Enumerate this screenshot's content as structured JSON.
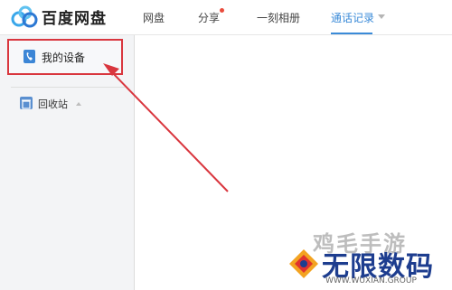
{
  "header": {
    "app_title": "百度网盘",
    "nav": [
      {
        "label": "网盘"
      },
      {
        "label": "分享"
      },
      {
        "label": "一刻相册"
      },
      {
        "label": "通话记录"
      }
    ]
  },
  "sidebar": {
    "items": [
      {
        "label": "我的设备",
        "icon": "phone-icon"
      },
      {
        "label": "回收站",
        "icon": "trash-icon"
      }
    ]
  },
  "colors": {
    "accent": "#3b8bd8",
    "annotation": "#d9363e",
    "notification_dot": "#e94b3c"
  },
  "watermark": {
    "top_text": "鸡毛手游",
    "main_text": "无限数码",
    "url": "WWW.WUXIAN.GROUP"
  }
}
